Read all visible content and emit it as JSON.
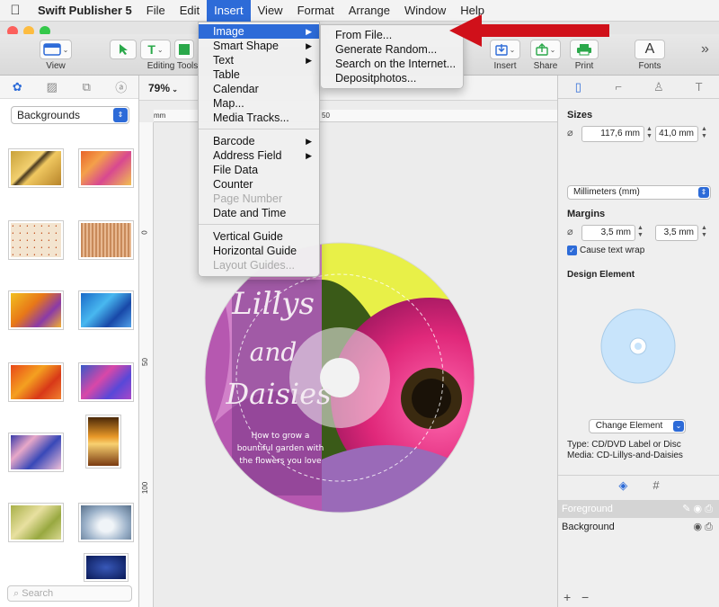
{
  "menubar": {
    "app_name": "Swift Publisher 5",
    "items": [
      "File",
      "Edit",
      "Insert",
      "View",
      "Format",
      "Arrange",
      "Window",
      "Help"
    ]
  },
  "toolbar": {
    "view_label": "View",
    "editing_tools_label": "Editing Tools",
    "insert_label": "Insert",
    "share_label": "Share",
    "print_label": "Print",
    "fonts_label": "Fonts",
    "fonts_glyph": "A",
    "overflow": "»"
  },
  "insert_menu": {
    "items": [
      {
        "label": "Image",
        "submenu": true,
        "selected": true,
        "disabled": false
      },
      {
        "label": "Smart Shape",
        "submenu": true,
        "selected": false,
        "disabled": false
      },
      {
        "label": "Text",
        "submenu": true,
        "selected": false,
        "disabled": false
      },
      {
        "label": "Table",
        "submenu": false,
        "selected": false,
        "disabled": false
      },
      {
        "label": "Calendar",
        "submenu": false,
        "selected": false,
        "disabled": false
      },
      {
        "label": "Map...",
        "submenu": false,
        "selected": false,
        "disabled": false
      },
      {
        "label": "Media Tracks...",
        "submenu": false,
        "selected": false,
        "disabled": false
      },
      {
        "label": "Barcode",
        "submenu": true,
        "selected": false,
        "disabled": false
      },
      {
        "label": "Address Field",
        "submenu": true,
        "selected": false,
        "disabled": false
      },
      {
        "label": "File Data",
        "submenu": false,
        "selected": false,
        "disabled": false
      },
      {
        "label": "Counter",
        "submenu": false,
        "selected": false,
        "disabled": false
      },
      {
        "label": "Page Number",
        "submenu": false,
        "selected": false,
        "disabled": true
      },
      {
        "label": "Date and Time",
        "submenu": false,
        "selected": false,
        "disabled": false
      },
      {
        "label": "Vertical Guide",
        "submenu": false,
        "selected": false,
        "disabled": false
      },
      {
        "label": "Horizontal Guide",
        "submenu": false,
        "selected": false,
        "disabled": false
      },
      {
        "label": "Layout Guides...",
        "submenu": false,
        "selected": false,
        "disabled": true
      }
    ],
    "submenu_arrow": "▶"
  },
  "image_submenu": {
    "items": [
      "From File...",
      "Generate Random...",
      "Search on the Internet...",
      "Depositphotos..."
    ]
  },
  "left_panel": {
    "category": "Backgrounds",
    "search_placeholder": "Search"
  },
  "canvas": {
    "zoom": "79%",
    "ruler_unit": "mm",
    "ruler_top": [
      "50"
    ],
    "ruler_left": [
      "0",
      "50",
      "100"
    ]
  },
  "disc_art": {
    "title_line1": "Lillys",
    "title_line2": "and",
    "title_line3": "Daisies",
    "subtitle_line1": "How to grow a",
    "subtitle_line2": "bountiful garden with",
    "subtitle_line3": "the flowers you love"
  },
  "inspector": {
    "sizes_label": "Sizes",
    "width": "117,6 mm",
    "height": "41,0 mm",
    "units": "Millimeters (mm)",
    "margins_label": "Margins",
    "margin_left": "3,5 mm",
    "margin_right": "3,5 mm",
    "cause_text_wrap": "Cause text wrap",
    "design_element_label": "Design Element",
    "change_element": "Change Element",
    "type_line": "Type: CD/DVD Label or Disc",
    "media_line": "Media: CD-Lillys-and-Daisies"
  },
  "layers": {
    "items": [
      "Foreground",
      "Background"
    ],
    "add": "+",
    "remove": "−"
  },
  "colors": {
    "accent": "#2d6bd8",
    "arrow": "#d0101a"
  }
}
